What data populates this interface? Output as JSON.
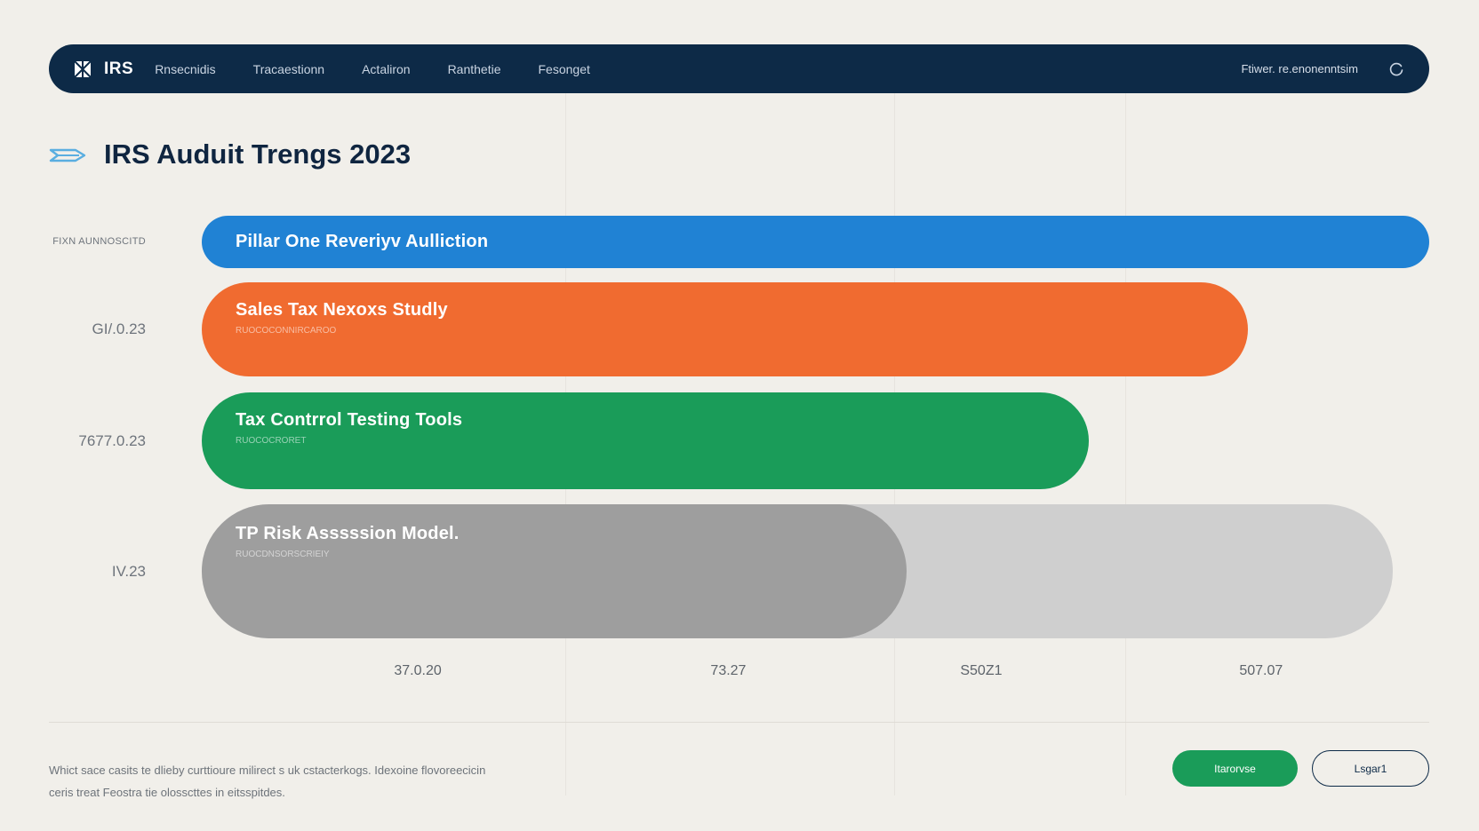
{
  "nav": {
    "brand": "IRS",
    "items": [
      "Rnsecnidis",
      "Tracaestionn",
      "Actaliron",
      "Ranthetie",
      "Fesonget"
    ],
    "user": "Ftiwer. re.enonenntsim"
  },
  "page": {
    "title": "IRS Auduit Trengs 2023"
  },
  "chart_data": {
    "type": "bar",
    "orientation": "horizontal",
    "title": "IRS Auduit Trengs 2023",
    "categories": [
      "Pillar One Reveriyv Aulliction",
      "Sales Tax Nexoxs Studly",
      "Tax Contrrol Testing Tools",
      "TP Risk Asssssion Model."
    ],
    "row_labels": [
      "FIXN AUNNOSCITD",
      "GI/.0.23",
      "7677.0.23",
      "IV.23"
    ],
    "sublabels": [
      "",
      "RUOCOCONNIRCAROO",
      "RUOCOCRORET",
      "RUOCDNSORSCRIEIY"
    ],
    "values": [
      100,
      85.2,
      72.3,
      57.4
    ],
    "track_value": 97,
    "colors": [
      "#2082d4",
      "#f06b30",
      "#1a9c59",
      "#9e9e9e"
    ],
    "x_ticks": [
      "37.0.20",
      "73.27",
      "S50Z1",
      "507.07"
    ],
    "x_tick_positions": [
      17.6,
      42.9,
      63.5,
      86.3
    ],
    "xlim": [
      0,
      100
    ],
    "grid": false,
    "legend": "none"
  },
  "footer": {
    "note": "Whict sace casits te dlieby curttioure milirect s uk cstacterkogs. Idexoine flovoreecicin ceris treat Feostra tie olosscttes in eitsspitdes.",
    "primary_button": "Itarorvse",
    "secondary_button": "Lsgar1"
  }
}
